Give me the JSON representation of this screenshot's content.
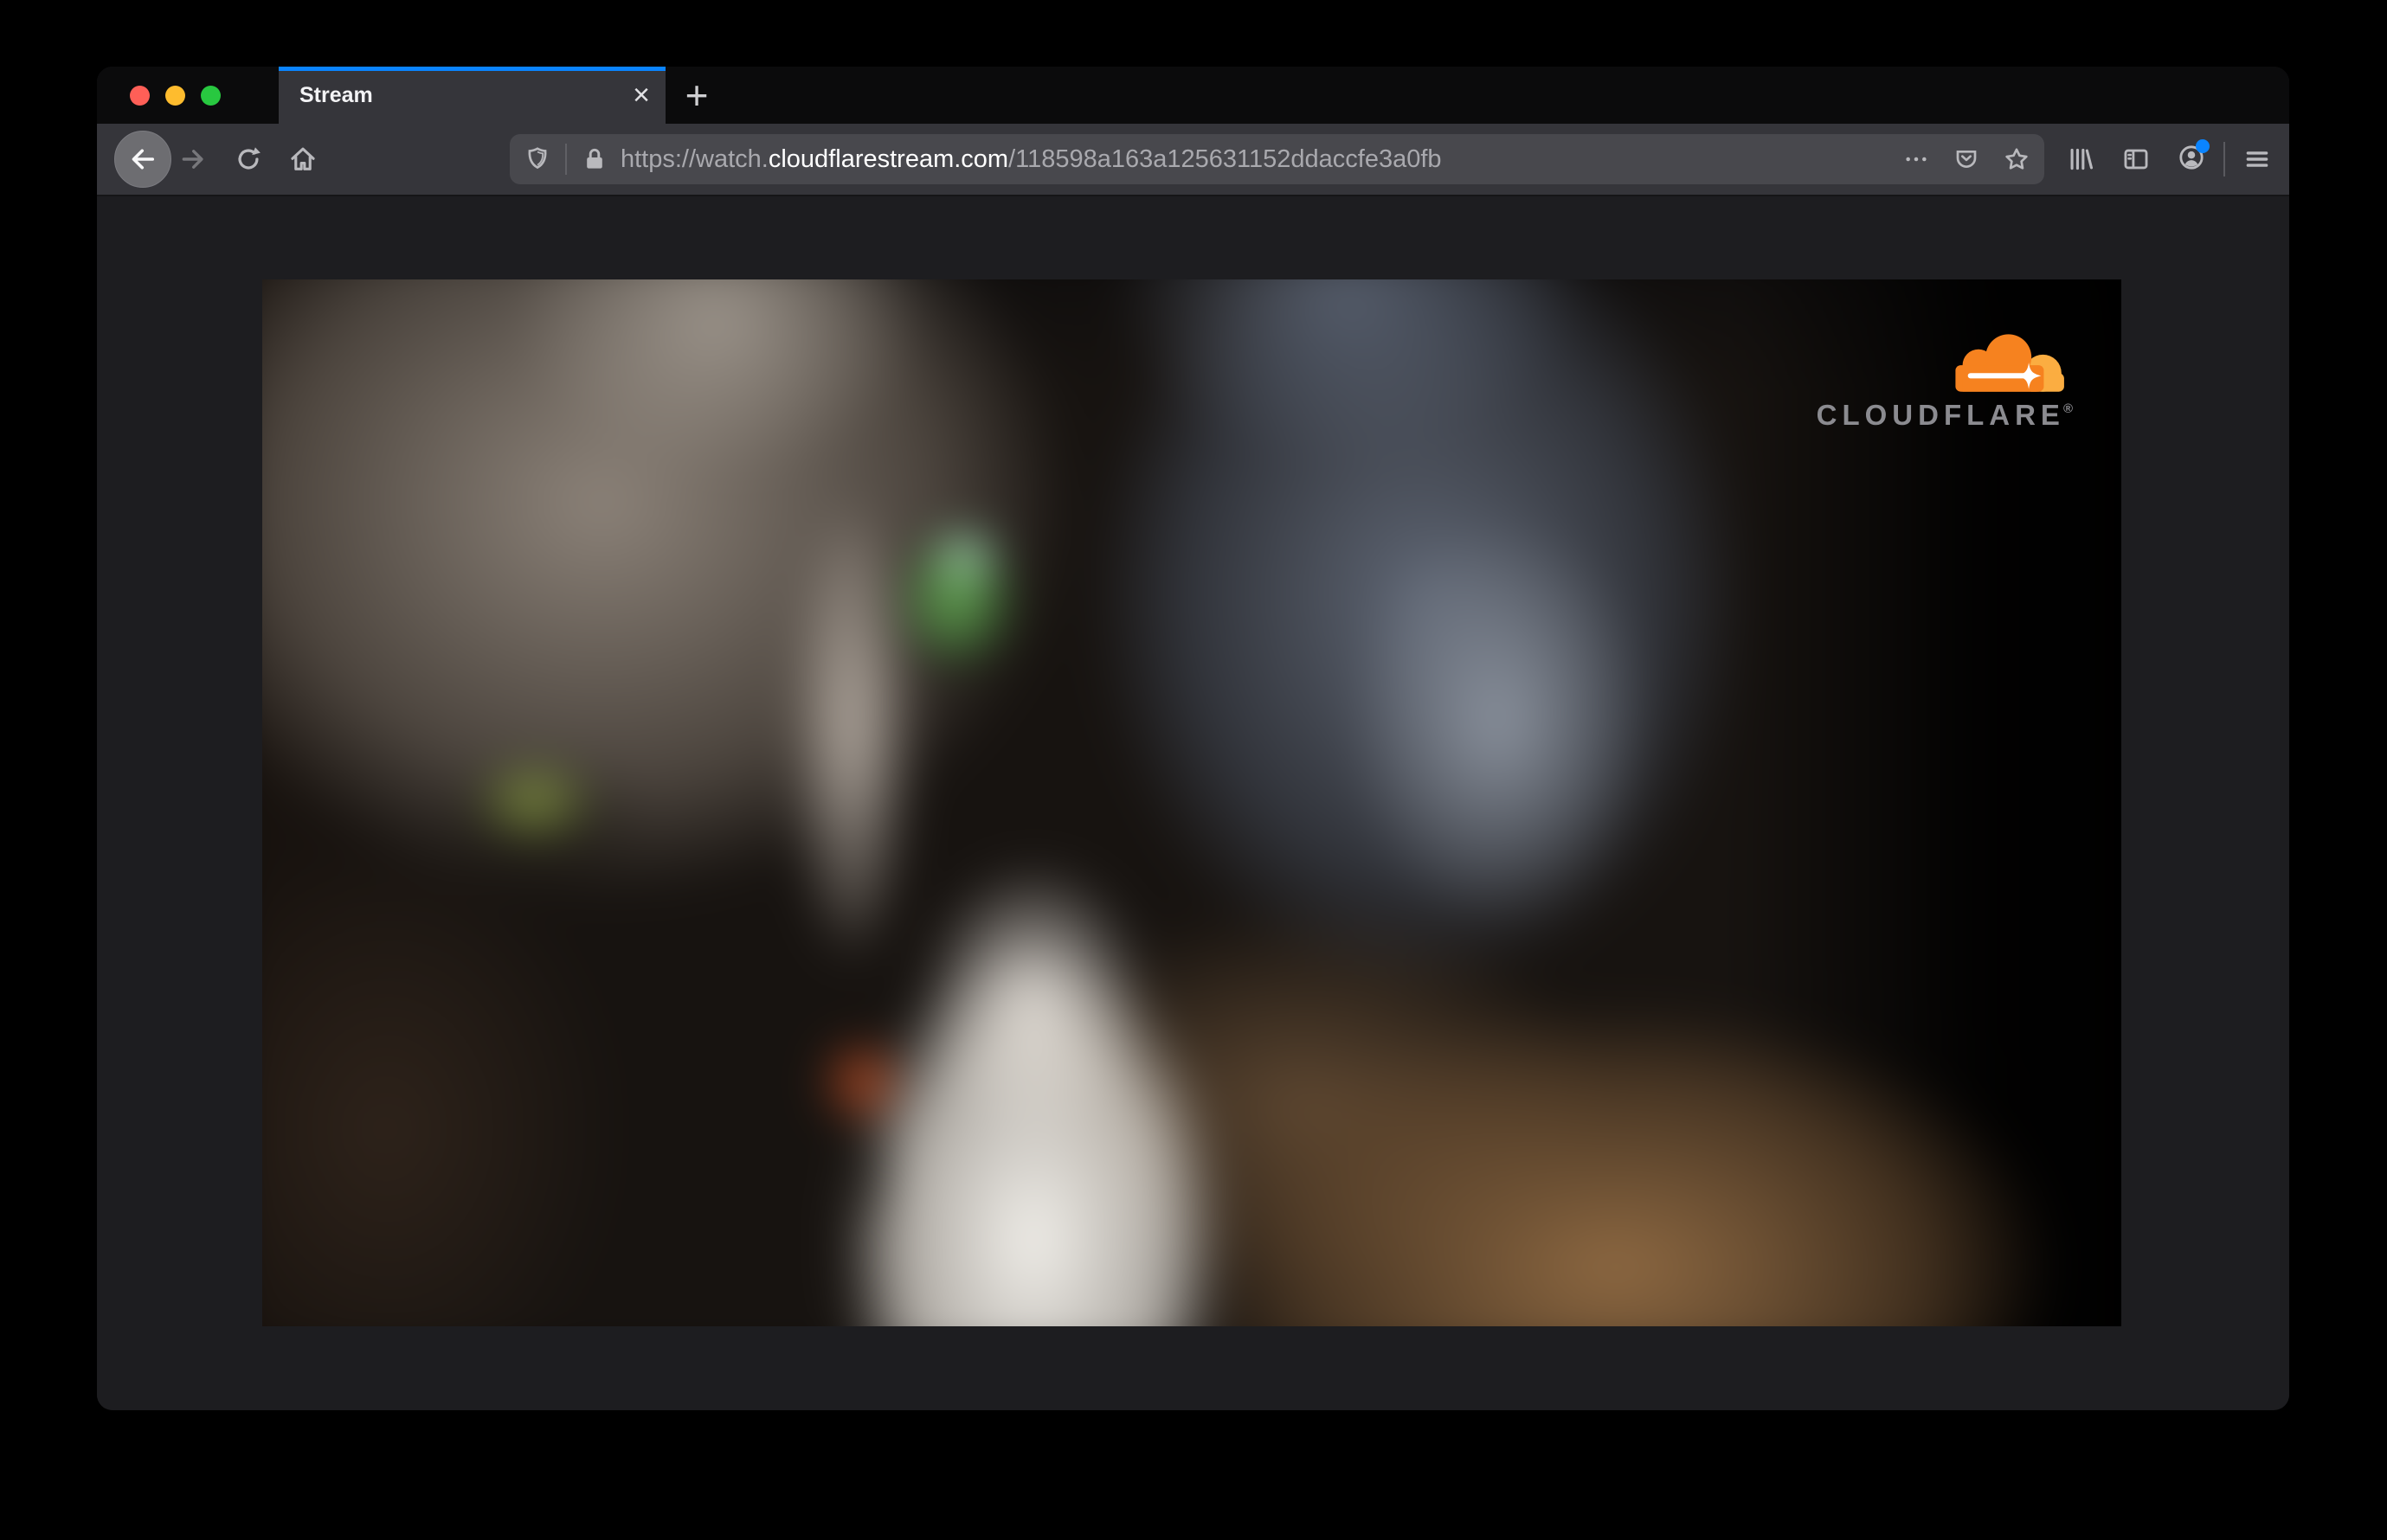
{
  "tab_bar": {
    "tab_title": "Stream",
    "tab_close_glyph": "×",
    "new_tab_glyph": "+"
  },
  "toolbar": {
    "url_prefix": "https://watch.",
    "url_domain": "cloudflarestream.com",
    "url_path": "/118598a163a125631152ddaccfe3a0fb"
  },
  "video": {
    "brand_name": "CLOUDFLARE",
    "brand_trademark": "®"
  },
  "colors": {
    "accent_blue": "#0a84ff",
    "cloudflare_orange": "#f6821f",
    "cloudflare_orange_light": "#fbad41",
    "traffic_red": "#ff5f57",
    "traffic_yellow": "#febc2e",
    "traffic_green": "#28c840",
    "toolbar_bg": "#35353a",
    "urlbar_bg": "#48484d",
    "tabbar_bg": "#0b0b0c",
    "page_bg": "#1d1d20"
  },
  "icons": {
    "back": "back-arrow",
    "forward": "forward-arrow",
    "reload": "reload-circular-arrow",
    "home": "house",
    "shield": "tracking-protection-shield",
    "lock": "padlock",
    "overflow": "three-dots",
    "pocket": "pocket-badge-chevron",
    "bookmark": "star-outline",
    "library": "book-spines",
    "sidebar": "panel-rectangle",
    "account": "person-in-circle",
    "menu": "hamburger-three-bars",
    "cloudflare": "orange-cloud-with-sparkle"
  }
}
